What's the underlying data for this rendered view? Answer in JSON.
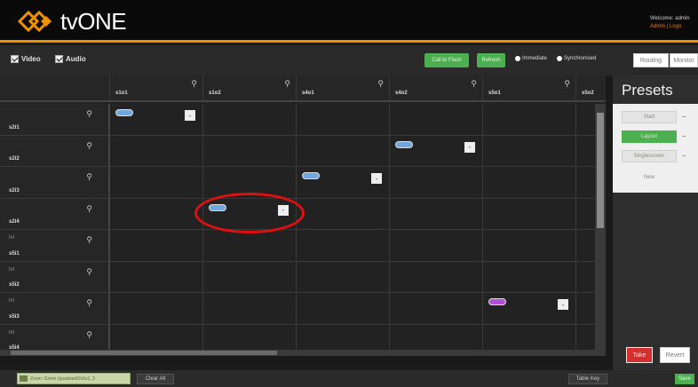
{
  "app": {
    "brand": "tvONE",
    "welcome_line": "Welcome: admin",
    "welcome_links": "Admin | Logo"
  },
  "toolbar": {
    "video_label": "Video",
    "audio_label": "Audio",
    "call_to_flash": "Call to Flash",
    "refresh": "Refresh",
    "radio_immediate": "Immediate",
    "radio_synchronised": "Synchronised",
    "tab_routing": "Routing",
    "tab_monitor": "Monitor"
  },
  "grid": {
    "columns": [
      "s1o1",
      "s1o2",
      "s4o1",
      "s4o2",
      "s5o1",
      "s5o2"
    ],
    "rows": [
      {
        "label": "s2i1",
        "bar": ""
      },
      {
        "label": "s2i2",
        "bar": ""
      },
      {
        "label": "s2i3",
        "bar": ""
      },
      {
        "label": "s2i4",
        "bar": ""
      },
      {
        "label": "s5i1",
        "bar": "lııl"
      },
      {
        "label": "s5i2",
        "bar": "lııl"
      },
      {
        "label": "s5i3",
        "bar": "lııl"
      },
      {
        "label": "s5i4",
        "bar": "lııl"
      }
    ],
    "routes": [
      {
        "row": 0,
        "col": 0,
        "color": "#6fa8dc"
      },
      {
        "row": 1,
        "col": 3,
        "color": "#6fa8dc"
      },
      {
        "row": 2,
        "col": 2,
        "color": "#6fa8dc"
      },
      {
        "row": 3,
        "col": 1,
        "color": "#6fa8dc"
      },
      {
        "row": 6,
        "col": 4,
        "color": "#b04fd8"
      }
    ],
    "mini_button": "-"
  },
  "presets": {
    "title": "Presets",
    "items": [
      {
        "label": "Start",
        "active": false
      },
      {
        "label": "Layout",
        "active": true
      },
      {
        "label": "Singlescreen",
        "active": false
      }
    ],
    "new_label": "New",
    "take": "Take",
    "revert": "Revert"
  },
  "footer": {
    "status": "Zoom: Green (quadrant2/s5o1_3",
    "clear_all": "Clear All",
    "table_key": "Table Key",
    "green_btn": "Save"
  },
  "colors": {
    "accent": "#f29100",
    "route_video": "#6fa8dc",
    "route_alt": "#b04fd8",
    "green": "#4caf50",
    "take": "#d32f2f",
    "annotation": "#e01010"
  }
}
